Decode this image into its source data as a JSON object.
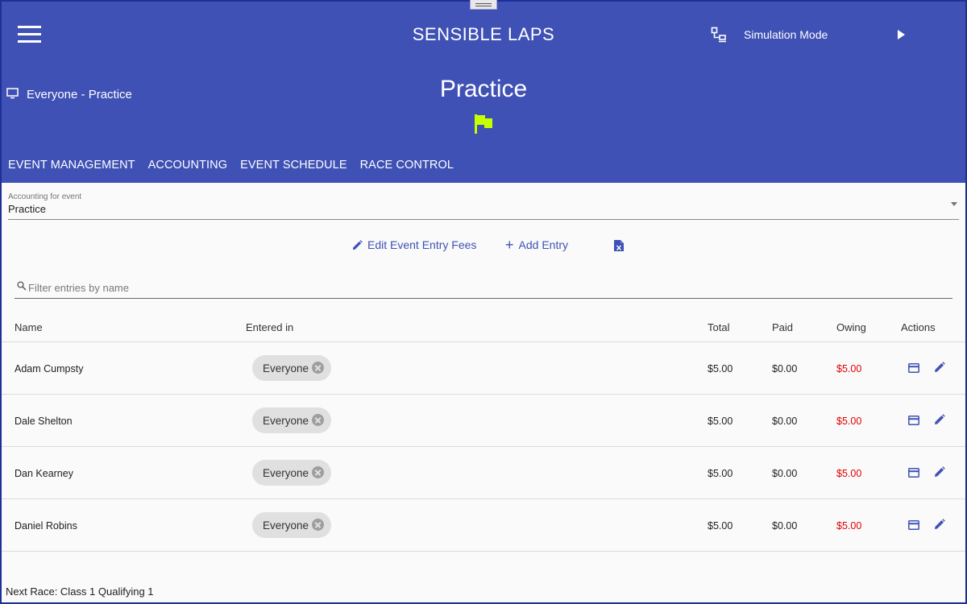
{
  "header": {
    "app_title": "SENSIBLE LAPS",
    "simulation_label": "Simulation Mode",
    "event_label": "Everyone - Practice",
    "page_title": "Practice",
    "tabs": [
      "EVENT MANAGEMENT",
      "ACCOUNTING",
      "EVENT SCHEDULE",
      "RACE CONTROL"
    ]
  },
  "accounting_select": {
    "label": "Accounting for event",
    "value": "Practice"
  },
  "actions": {
    "edit_fees_label": "Edit Event Entry Fees",
    "add_entry_label": "Add Entry"
  },
  "filter": {
    "placeholder": "Filter entries by name"
  },
  "table": {
    "columns": {
      "name": "Name",
      "entered_in": "Entered in",
      "total": "Total",
      "paid": "Paid",
      "owing": "Owing",
      "actions": "Actions"
    },
    "rows": [
      {
        "name": "Adam Cumpsty",
        "entered_in": "Everyone",
        "total": "$5.00",
        "paid": "$0.00",
        "owing": "$5.00"
      },
      {
        "name": "Dale Shelton",
        "entered_in": "Everyone",
        "total": "$5.00",
        "paid": "$0.00",
        "owing": "$5.00"
      },
      {
        "name": "Dan Kearney",
        "entered_in": "Everyone",
        "total": "$5.00",
        "paid": "$0.00",
        "owing": "$5.00"
      },
      {
        "name": "Daniel Robins",
        "entered_in": "Everyone",
        "total": "$5.00",
        "paid": "$0.00",
        "owing": "$5.00"
      }
    ]
  },
  "footer": {
    "next_race": "Next Race: Class 1 Qualifying 1"
  },
  "colors": {
    "primary": "#3f51b5",
    "flag": "#c6ff00",
    "owing": "#e00000"
  },
  "icons": {
    "menu": "menu-icon",
    "simulation": "simulation-icon",
    "play": "play-icon",
    "monitor": "monitor-icon",
    "flag": "flag-icon",
    "pencil": "pencil-icon",
    "plus": "plus-icon",
    "excel": "excel-export-icon",
    "search": "search-icon",
    "payment": "credit-card-icon",
    "remove": "close-circle-icon"
  }
}
